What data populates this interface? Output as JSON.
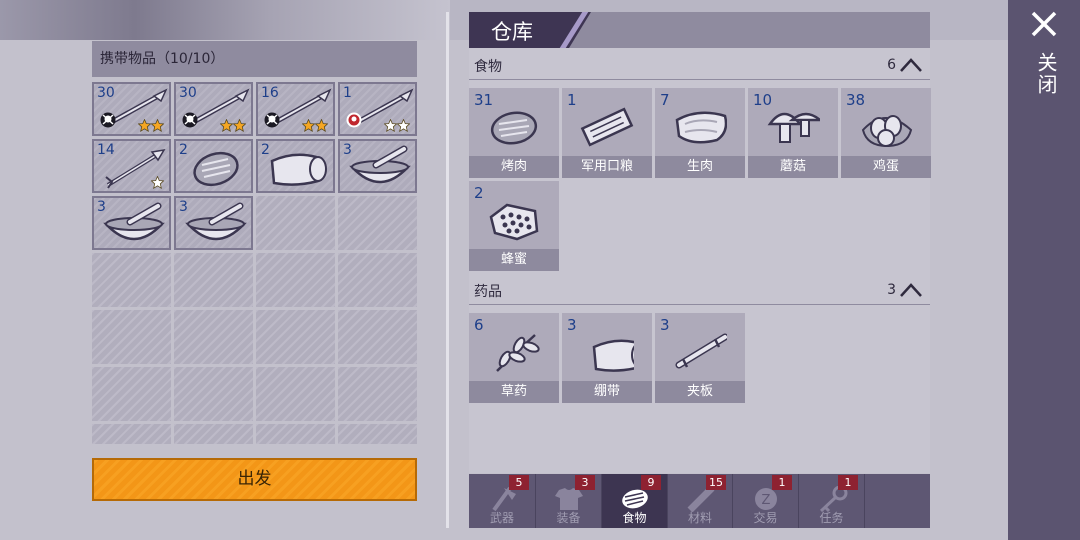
{
  "carry": {
    "title": "携带物品（10/10）",
    "items": [
      {
        "qty": "30",
        "icon": "spear-icon",
        "badge": "skull",
        "stars": 2,
        "star_color": "#f5a623"
      },
      {
        "qty": "30",
        "icon": "spear-icon",
        "badge": "skull",
        "stars": 2,
        "star_color": "#f5a623"
      },
      {
        "qty": "16",
        "icon": "spear-icon",
        "badge": "skull",
        "stars": 2,
        "star_color": "#f5a623"
      },
      {
        "qty": "1",
        "icon": "spear-icon",
        "badge": "red-head",
        "stars": 2,
        "star_color": "#ffffff"
      },
      {
        "qty": "14",
        "icon": "arrow-icon",
        "badge": "",
        "stars": 1,
        "star_color": "#ffffff"
      },
      {
        "qty": "2",
        "icon": "meat-icon",
        "badge": "",
        "stars": 0
      },
      {
        "qty": "2",
        "icon": "bandage-icon",
        "badge": "",
        "stars": 0
      },
      {
        "qty": "3",
        "icon": "mortar-icon",
        "badge": "",
        "stars": 0
      },
      {
        "qty": "3",
        "icon": "mortar-icon",
        "badge": "",
        "stars": 0
      },
      {
        "qty": "3",
        "icon": "mortar-icon",
        "badge": "",
        "stars": 0
      }
    ],
    "depart_label": "出发"
  },
  "warehouse": {
    "title": "仓库",
    "sections": [
      {
        "name": "食物",
        "count": "6",
        "items": [
          {
            "qty": "31",
            "label": "烤肉",
            "icon": "roast-meat-icon"
          },
          {
            "qty": "1",
            "label": "军用口粮",
            "icon": "ration-icon"
          },
          {
            "qty": "7",
            "label": "生肉",
            "icon": "raw-meat-icon"
          },
          {
            "qty": "10",
            "label": "蘑菇",
            "icon": "mushroom-icon"
          },
          {
            "qty": "38",
            "label": "鸡蛋",
            "icon": "egg-icon"
          },
          {
            "qty": "2",
            "label": "蜂蜜",
            "icon": "honeycomb-icon"
          }
        ]
      },
      {
        "name": "药品",
        "count": "3",
        "items": [
          {
            "qty": "6",
            "label": "草药",
            "icon": "herb-icon"
          },
          {
            "qty": "3",
            "label": "绷带",
            "icon": "bandage-icon"
          },
          {
            "qty": "3",
            "label": "夹板",
            "icon": "splint-icon"
          }
        ]
      }
    ]
  },
  "tabs": [
    {
      "label": "武器",
      "badge": "5",
      "icon": "axe-icon",
      "active": false
    },
    {
      "label": "装备",
      "badge": "3",
      "icon": "shirt-icon",
      "active": false
    },
    {
      "label": "食物",
      "badge": "9",
      "icon": "meat-icon",
      "active": true
    },
    {
      "label": "材料",
      "badge": "15",
      "icon": "plank-icon",
      "active": false
    },
    {
      "label": "交易",
      "badge": "1",
      "icon": "coin-icon",
      "active": false
    },
    {
      "label": "任务",
      "badge": "1",
      "icon": "key-icon",
      "active": false
    }
  ],
  "close_label": "关闭",
  "colors": {
    "accent_orange": "#f39617",
    "badge_red": "#8e2231",
    "qty_blue": "#1e3f8a"
  }
}
